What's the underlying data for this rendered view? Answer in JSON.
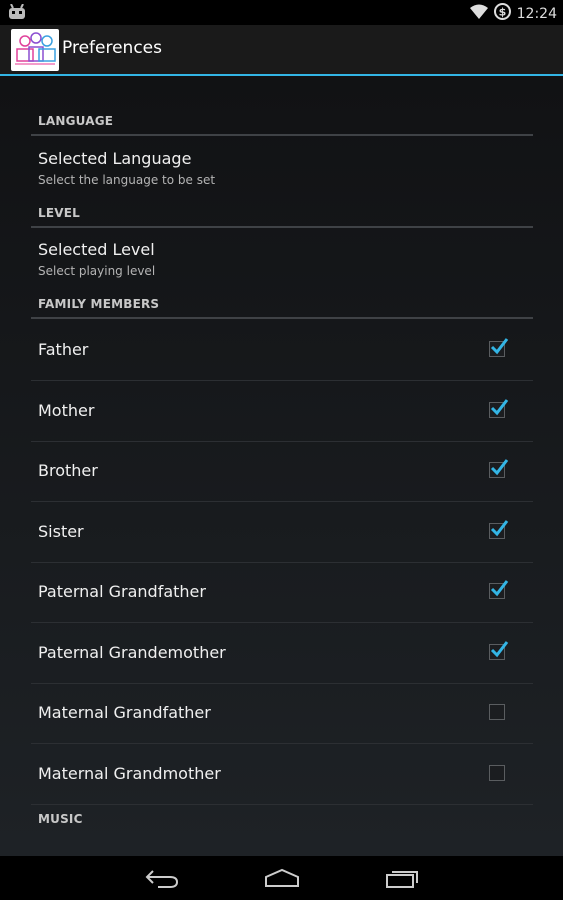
{
  "status_bar": {
    "time": "12:24"
  },
  "action_bar": {
    "title": "Preferences"
  },
  "sections": {
    "language": {
      "header": "LANGUAGE",
      "item": {
        "title": "Selected Language",
        "summary": "Select the language to be set"
      }
    },
    "level": {
      "header": "LEVEL",
      "item": {
        "title": "Selected Level",
        "summary": "Select playing level"
      }
    },
    "family": {
      "header": "FAMILY MEMBERS",
      "items": [
        {
          "label": "Father",
          "checked": true
        },
        {
          "label": "Mother",
          "checked": true
        },
        {
          "label": "Brother",
          "checked": true
        },
        {
          "label": "Sister",
          "checked": true
        },
        {
          "label": "Paternal Grandfather",
          "checked": true
        },
        {
          "label": "Paternal Grandemother",
          "checked": true
        },
        {
          "label": "Maternal Grandfather",
          "checked": false
        },
        {
          "label": "Maternal Grandmother",
          "checked": false
        }
      ]
    },
    "music": {
      "header": "MUSIC"
    }
  },
  "colors": {
    "accent": "#33b5e5",
    "background": "#151719"
  }
}
